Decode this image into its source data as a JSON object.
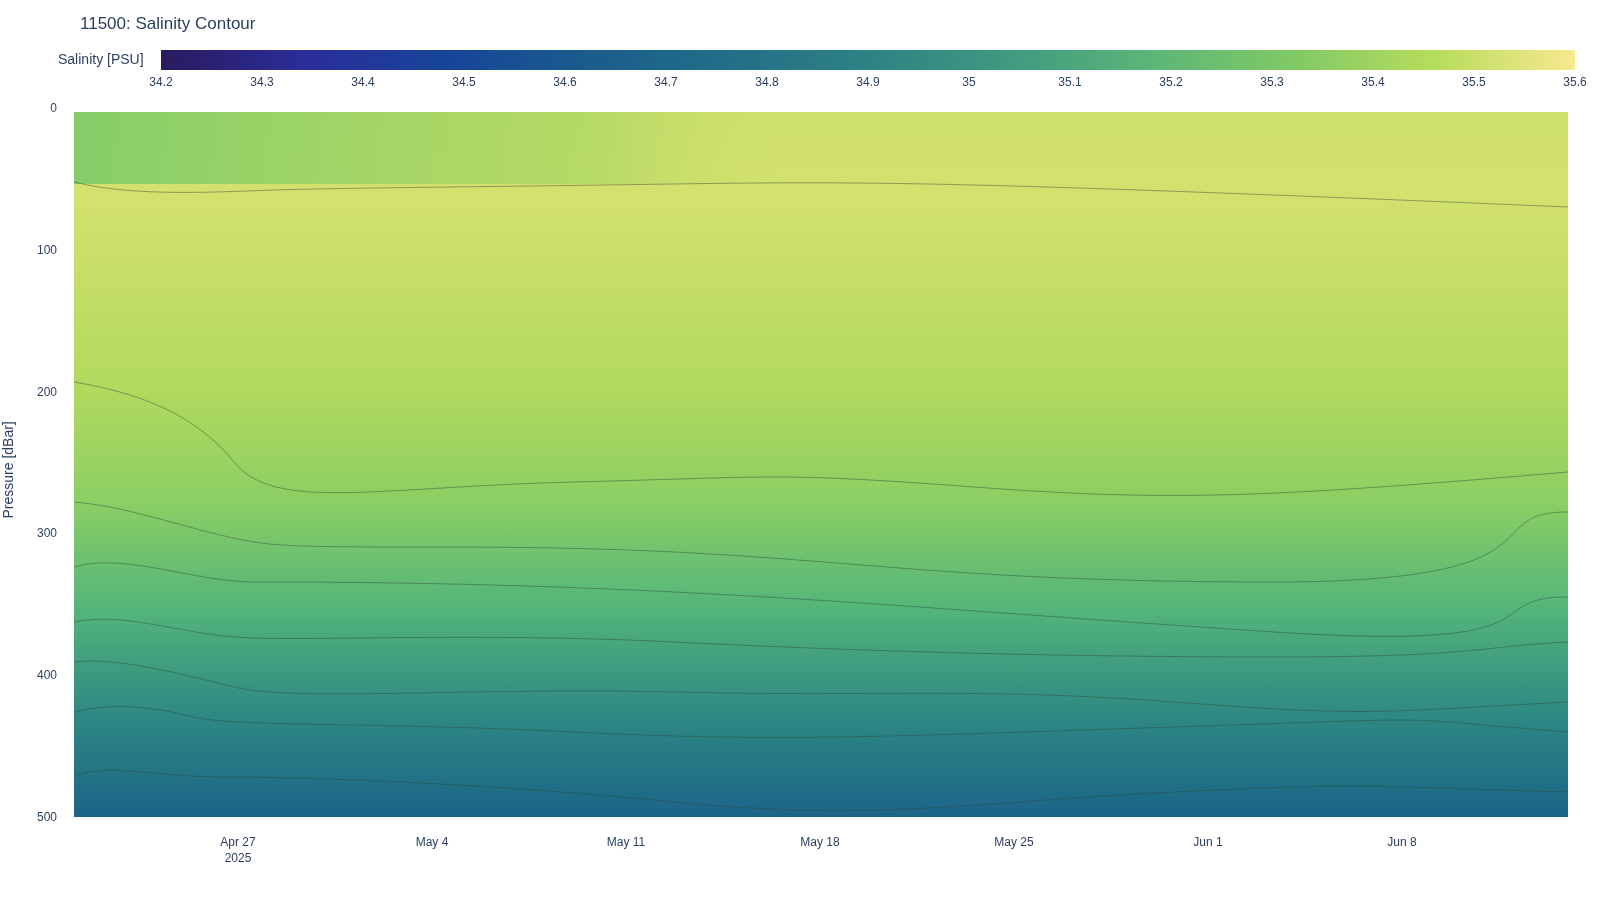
{
  "title": "11500: Salinity Contour",
  "colorbar": {
    "label": "Salinity [PSU]",
    "ticks": [
      "34.2",
      "34.3",
      "34.4",
      "34.5",
      "34.6",
      "34.7",
      "34.8",
      "34.9",
      "35",
      "35.1",
      "35.2",
      "35.3",
      "35.4",
      "35.5",
      "35.6"
    ]
  },
  "y_axis": {
    "title": "Pressure [dBar]",
    "ticks": [
      "0",
      "100",
      "200",
      "300",
      "400",
      "500"
    ]
  },
  "x_axis": {
    "ticks": [
      {
        "label": "Apr 27",
        "sublabel": "2025"
      },
      {
        "label": "May 4"
      },
      {
        "label": "May 11"
      },
      {
        "label": "May 18"
      },
      {
        "label": "May 25"
      },
      {
        "label": "Jun 1"
      },
      {
        "label": "Jun 8"
      }
    ]
  }
}
